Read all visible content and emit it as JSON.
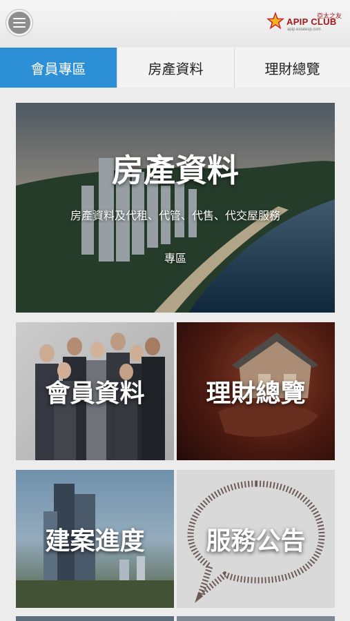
{
  "header": {
    "menu_icon": "hamburger-menu-icon",
    "logo_text": "APIP CLUB",
    "logo_cn": "亞太之友",
    "logo_url": "apip.estatesp.com"
  },
  "tabs": [
    {
      "label": "會員專區",
      "active": true
    },
    {
      "label": "房產資料",
      "active": false
    },
    {
      "label": "理財總覽",
      "active": false
    }
  ],
  "hero": {
    "title": "房產資料",
    "subtitle": "房產資料及代租、代管、代售、代交屋服務",
    "subtitle2": "專區"
  },
  "tiles": [
    {
      "label": "會員資料"
    },
    {
      "label": "理財總覽"
    },
    {
      "label": "建案進度"
    },
    {
      "label": "服務公告"
    }
  ],
  "colors": {
    "accent": "#2d8fd6",
    "brand": "#a3161d"
  }
}
